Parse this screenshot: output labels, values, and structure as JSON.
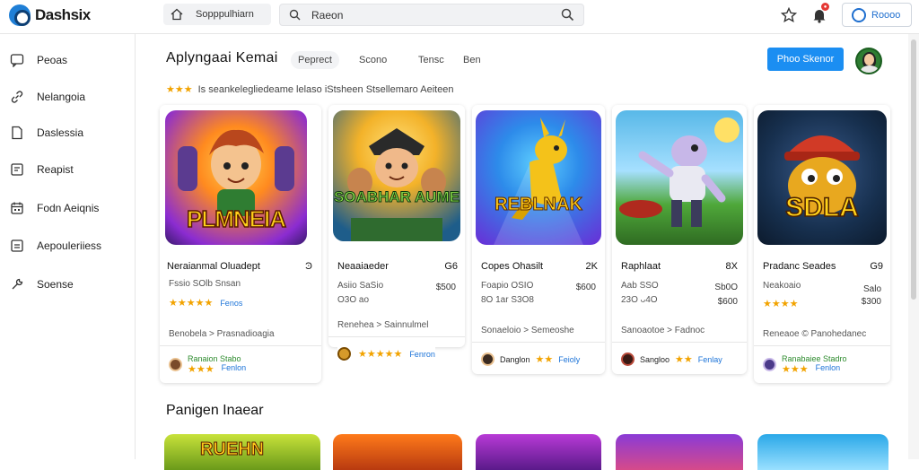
{
  "app": {
    "logo_text": "Dashsix"
  },
  "topbar": {
    "home_label": "Sopppulhiarn",
    "search_value": "Raeon",
    "account_label": "Roooo"
  },
  "sidebar": {
    "items": [
      {
        "label": "Peoas",
        "icon": "chat-icon"
      },
      {
        "label": "Nelangoia",
        "icon": "link-icon"
      },
      {
        "label": "Daslessia",
        "icon": "document-icon"
      },
      {
        "label": "Reapist",
        "icon": "image-icon"
      },
      {
        "label": "Fodn Aeiqnis",
        "icon": "calendar-icon"
      },
      {
        "label": "Aepouleriiess",
        "icon": "chart-icon"
      },
      {
        "label": "Soense",
        "icon": "settings-icon"
      }
    ]
  },
  "main": {
    "title": "Aplyngaai Kemai",
    "filters": [
      "Peprect",
      "Scono",
      "Tensc",
      "Ben"
    ],
    "cta_label": "Phoo Skenor",
    "rating_text": "Is seankelegliedeame lelaso iStsheen Stsellemaro Aeiteen",
    "section_title": "Panigen Inaear"
  },
  "cards": [
    {
      "art_title": "PLMNEIA",
      "name": "Neraianmal Oluadept",
      "tag": "Ͽ",
      "meta": "Fssio  SOlb Snsan",
      "link": "Fenos",
      "tags_line": "Benobela > Prasnadioagia",
      "footer_name": "Ranaion Stabo",
      "footer_link": "Fenlon",
      "colors": [
        "#ff9a1f",
        "#7a2cd1"
      ]
    },
    {
      "art_title": "SOABHAR AUME",
      "name": "Neaaiaeder",
      "tag": "G6",
      "meta": "Asiio  SaSio",
      "meta2": "O3O  ao",
      "price": "$500",
      "tags_line": "Renehea > Sainnulmel",
      "footer_link": "Fenron",
      "colors": [
        "#f3b229",
        "#1e5d8a"
      ]
    },
    {
      "art_title": "REBLNAK",
      "name": "Copes Ohasilt",
      "tag": "2K",
      "meta": "Foapio  OSIO",
      "meta2": "8O  1ar  S3O8",
      "price": "$600",
      "tags_line": "Sonaeloio > Semeoshe",
      "footer_name": "Danglon",
      "footer_link": "Feioly",
      "colors": [
        "#2d8bea",
        "#6a2dd6"
      ]
    },
    {
      "art_title": "",
      "name": "Raphlaat",
      "tag": "8X",
      "meta": "Aab  SSO",
      "meta2": "23O  ᴗ4O",
      "price": "$600",
      "price2": "Sb0O",
      "tags_line": "Sanoaotoe > Fadnoc",
      "footer_name": "Sangloo",
      "footer_link": "Fenlay",
      "colors": [
        "#58b8e8",
        "#3f8f2f"
      ]
    },
    {
      "art_title": "SDLA",
      "name": "Pradanc Seades",
      "tag": "G9",
      "meta": "Neakoaio",
      "meta2": "",
      "price": "Salo",
      "price2": "$300",
      "tags_line": "Reneaoe © Panohedanec",
      "footer_name": "Ranabaiee Stadro",
      "footer_link": "Fenlon",
      "colors": [
        "#17304f",
        "#c52d1e"
      ]
    }
  ]
}
